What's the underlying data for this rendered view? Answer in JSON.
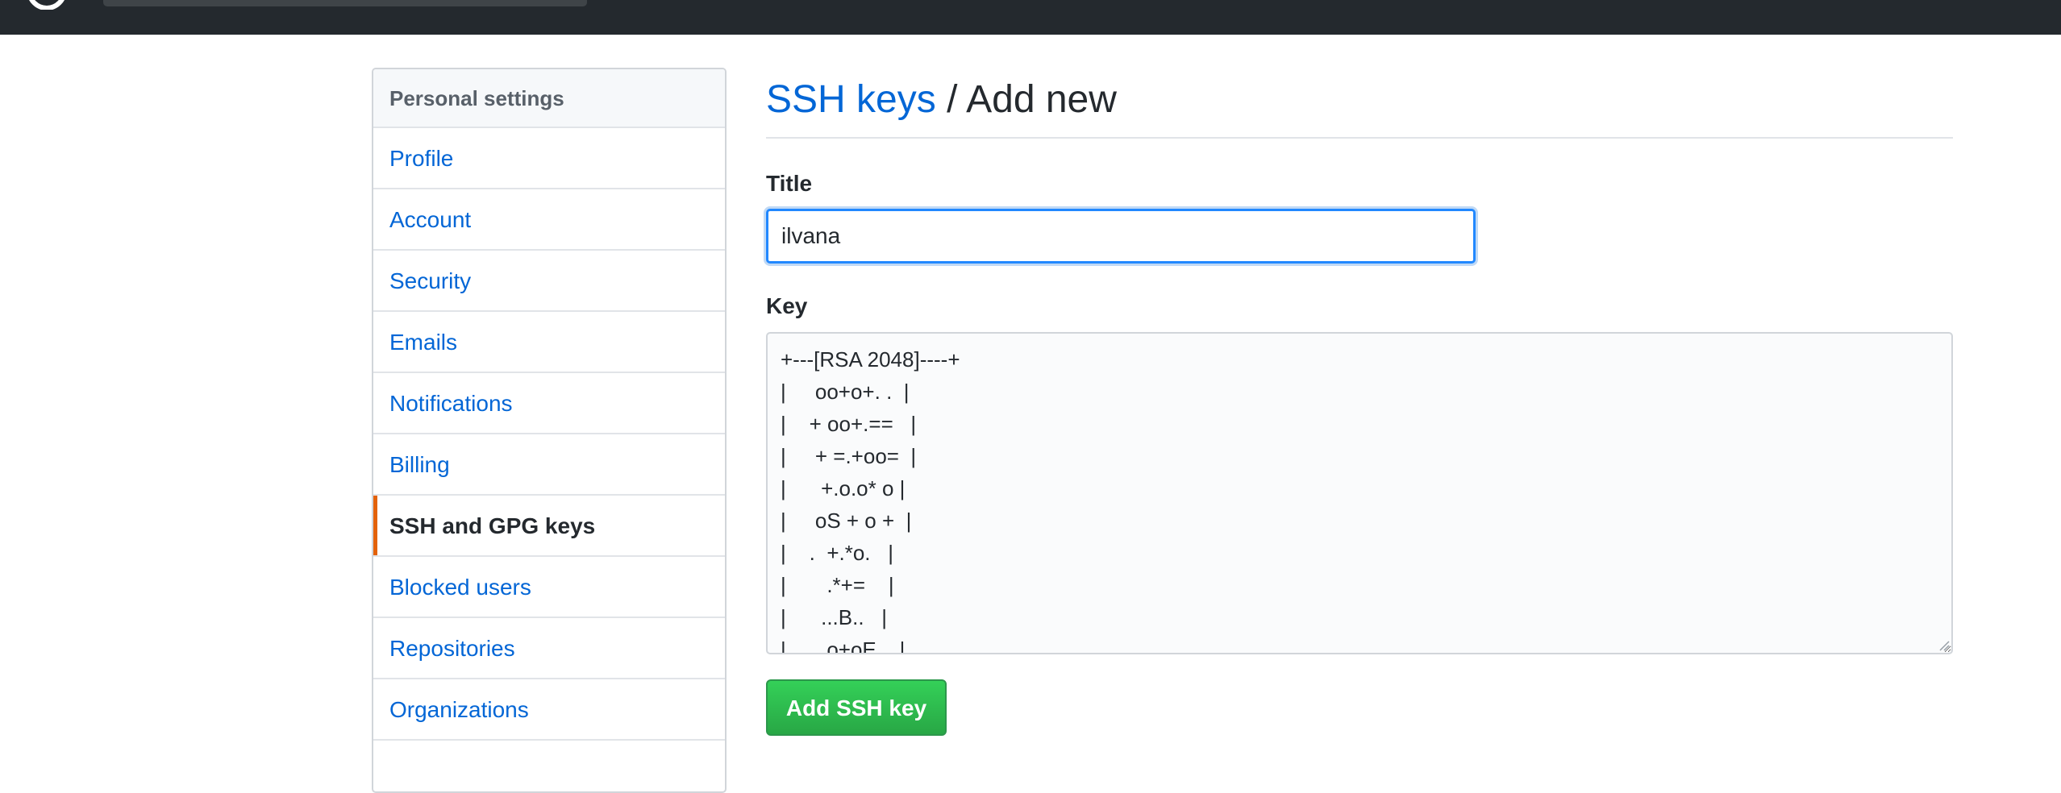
{
  "header": {
    "logo_icon": "github-octocat-icon",
    "search_placeholder": ""
  },
  "sidebar": {
    "heading": "Personal settings",
    "items": [
      {
        "label": "Profile"
      },
      {
        "label": "Account"
      },
      {
        "label": "Security"
      },
      {
        "label": "Emails"
      },
      {
        "label": "Notifications"
      },
      {
        "label": "Billing"
      },
      {
        "label": "SSH and GPG keys",
        "selected": true
      },
      {
        "label": "Blocked users"
      },
      {
        "label": "Repositories"
      },
      {
        "label": "Organizations"
      },
      {
        "label": ""
      }
    ],
    "selected_accent": "#e36209"
  },
  "main": {
    "breadcrumb_link": "SSH keys",
    "breadcrumb_sep": "/",
    "breadcrumb_current": "Add new",
    "title_label": "Title",
    "title_value": "ilvana",
    "key_label": "Key",
    "key_value": "+---[RSA 2048]----+\n|     oo+o+. .  |\n|    + oo+.==   |\n|     + =.+oo=  |\n|      +.o.o* o |\n|     oS + o +  |\n|    .  +.*o.   |\n|       .*+=    |\n|      ...B..   |\n|       o+oE    |",
    "submit_label": "Add SSH key"
  },
  "colors": {
    "link": "#0366d6",
    "topbar": "#24292e",
    "button_green": "#28a745",
    "focus_blue": "#2188ff"
  }
}
